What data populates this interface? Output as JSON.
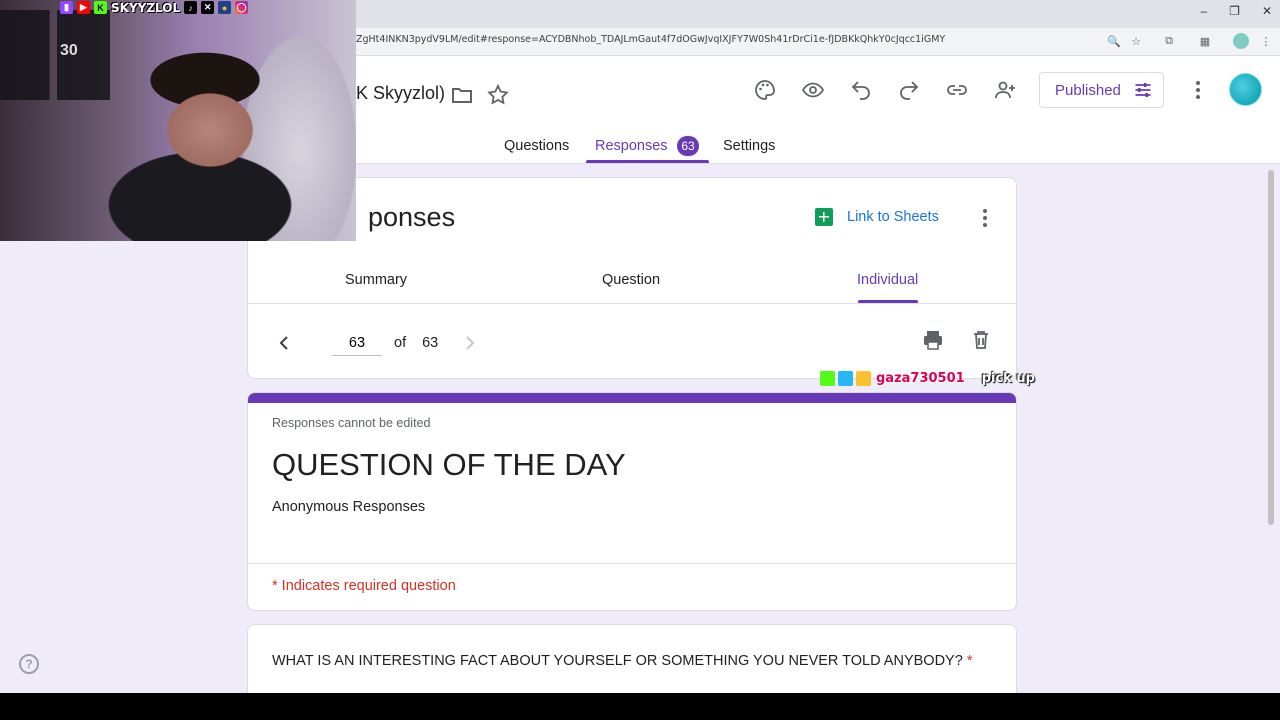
{
  "browser": {
    "url": "ZgHt4INKN3pydV9LM/edit#response=ACYDBNhob_TDAJLmGaut4f7dOGwJvqIXJFY7W0Sh41rDrCi1e-fJDBKkQhkY0cJqcc1iGMY"
  },
  "header": {
    "doc_title": "K Skyyzlol)",
    "published_label": "Published",
    "tabs": {
      "questions": "Questions",
      "responses": "Responses",
      "responses_count": "63",
      "settings": "Settings"
    }
  },
  "responses_card": {
    "title": "ponses",
    "link_to_sheets": "Link to Sheets",
    "subtabs": {
      "summary": "Summary",
      "question": "Question",
      "individual": "Individual"
    },
    "pager": {
      "current": "63",
      "of_label": "of",
      "total": "63"
    }
  },
  "form_card": {
    "notice": "Responses cannot be edited",
    "title": "QUESTION OF THE DAY",
    "description": "Anonymous Responses",
    "required_note": "* Indicates required question"
  },
  "question_card": {
    "text": "WHAT IS AN INTERESTING FACT ABOUT YOURSELF OR SOMETHING YOU NEVER TOLD ANYBODY?",
    "required_mark": "*"
  },
  "overlay": {
    "social_handle": "SKYYZLOL",
    "shirt_number": "30",
    "chat_user": "gaza730501",
    "chat_text": "pick up"
  },
  "colors": {
    "accent": "#673ab7",
    "link": "#1a73e8",
    "required": "#d93025",
    "background": "#f0ebf8"
  }
}
